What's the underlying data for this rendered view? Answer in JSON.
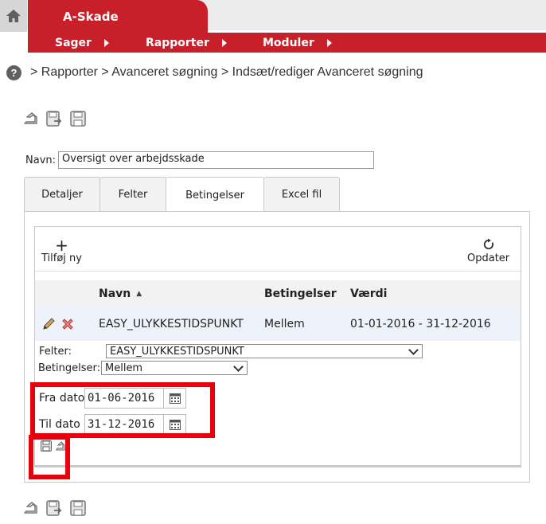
{
  "app": {
    "tab_title": "A-Skade"
  },
  "menu": {
    "items": [
      {
        "label": "Sager"
      },
      {
        "label": "Rapporter"
      },
      {
        "label": "Moduler"
      }
    ]
  },
  "breadcrumb": {
    "text": "> Rapporter > Avanceret søgning > Indsæt/rediger Avanceret søgning"
  },
  "form": {
    "name_label": "Navn:",
    "name_value": "Oversigt over arbejdsskade"
  },
  "tabs": [
    {
      "label": "Detaljer"
    },
    {
      "label": "Felter"
    },
    {
      "label": "Betingelser",
      "active": true
    },
    {
      "label": "Excel fil"
    }
  ],
  "grid_toolbar": {
    "add_label": "Tilføj ny",
    "refresh_label": "Opdater"
  },
  "grid": {
    "columns": [
      {
        "label": "Navn"
      },
      {
        "label": "Betingelser"
      },
      {
        "label": "Værdi"
      }
    ],
    "rows": [
      {
        "navn": "EASY_ULYKKESTIDSPUNKT",
        "betingelser": "Mellem",
        "vaerdi": "01-01-2016 - 31-12-2016"
      }
    ]
  },
  "edit": {
    "felter_label": "Felter:",
    "felter_value": "EASY_ULYKKESTIDSPUNKT",
    "betingelser_label": "Betingelser:",
    "betingelser_value": "Mellem",
    "fra_label": "Fra dato",
    "fra_value": "01-06-2016",
    "til_label": "Til dato",
    "til_value": "31-12-2016"
  },
  "colors": {
    "brand": "#c8202b",
    "highlight": "#e8000b",
    "row_selected": "#eef3fb"
  },
  "icons": [
    "home-icon",
    "help-icon",
    "back-icon",
    "save-close-icon",
    "save-icon",
    "add-icon",
    "refresh-icon",
    "edit-icon",
    "delete-icon",
    "calendar-icon"
  ]
}
